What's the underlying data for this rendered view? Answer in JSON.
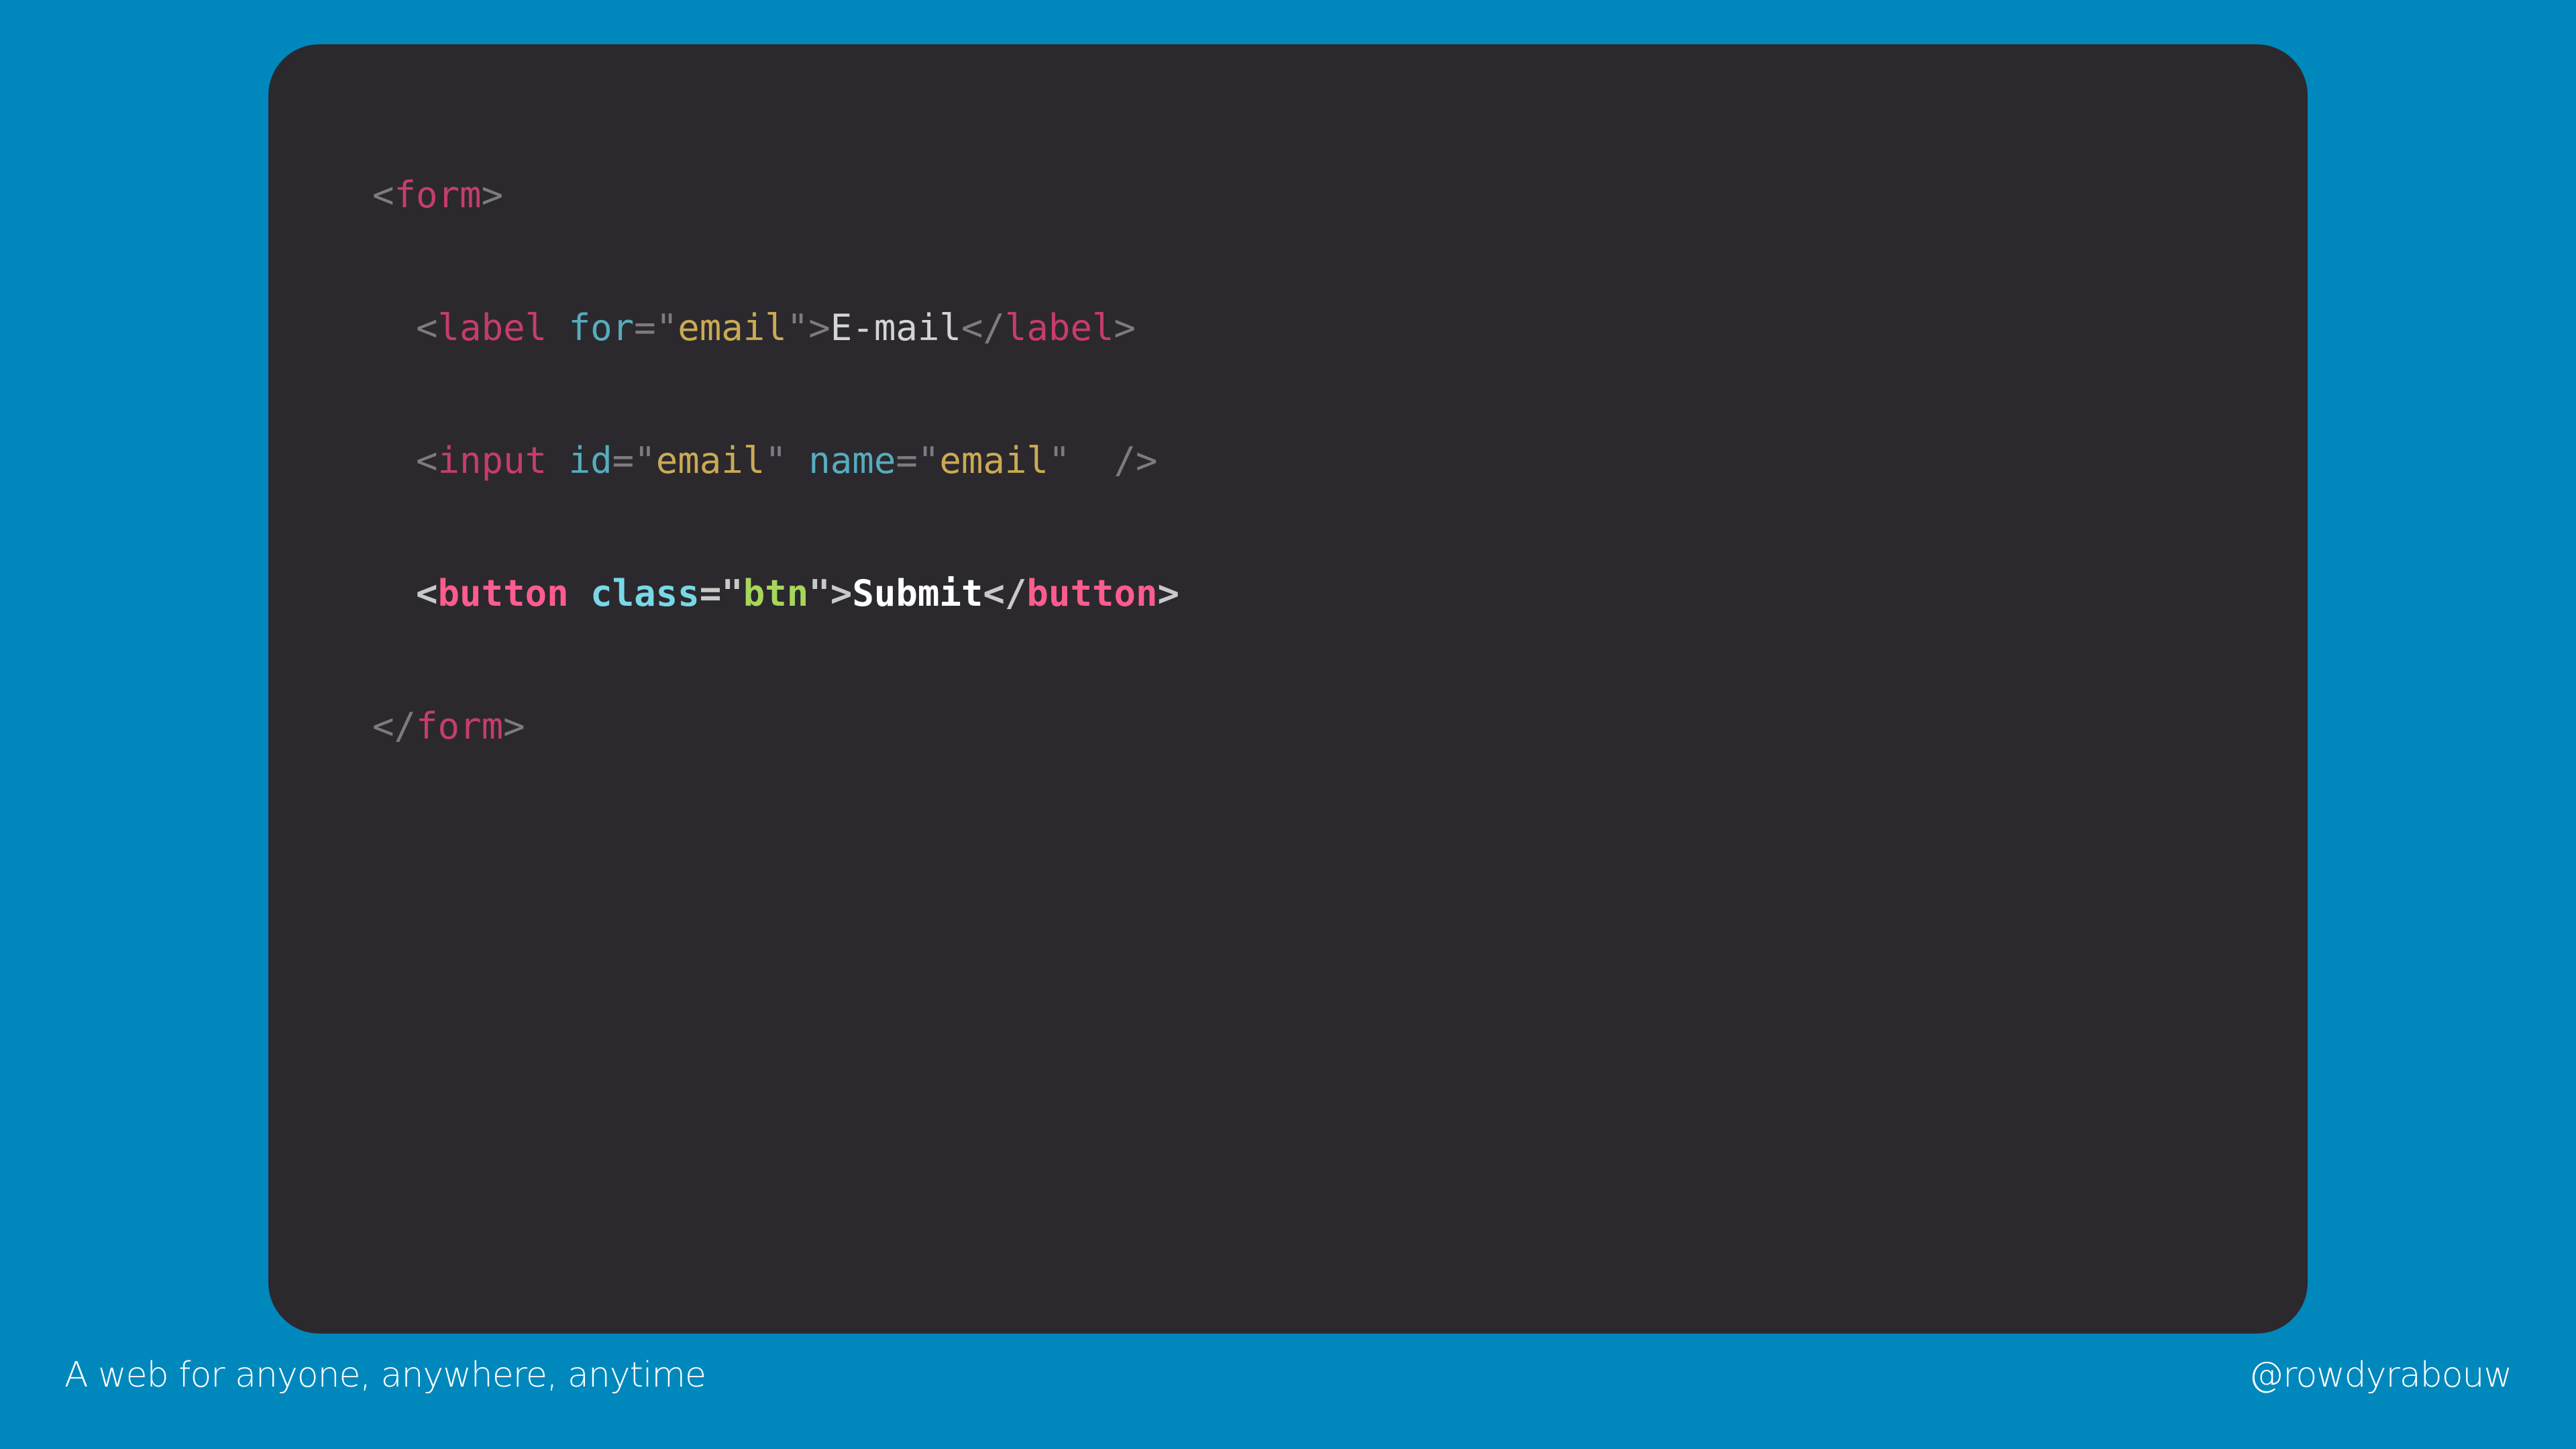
{
  "slide": {
    "background_color": "#0088bd",
    "panel_color": "#2b292e"
  },
  "code": {
    "line1": {
      "open": "<",
      "tag": "form",
      "close": ">"
    },
    "line2": {
      "indent": "  ",
      "open": "<",
      "tag": "label",
      "attr": "for",
      "eq": "=",
      "q1": "\"",
      "value": "email",
      "q2": "\"",
      "close": ">",
      "text": "E-mail",
      "end_open": "</",
      "end_tag": "label",
      "end_close": ">"
    },
    "line3": {
      "indent": "  ",
      "open": "<",
      "tag": "input",
      "attr1": "id",
      "eq1": "=",
      "q1": "\"",
      "value1": "email",
      "q2": "\"",
      "attr2": "name",
      "eq2": "=",
      "q3": "\"",
      "value2": "email",
      "q4": "\"",
      "self_close": "/>"
    },
    "line4": {
      "indent": "  ",
      "open": "<",
      "tag": "button",
      "attr": "class",
      "eq": "=",
      "q1": "\"",
      "value": "btn",
      "q2": "\"",
      "close": ">",
      "text": "Submit",
      "end_open": "</",
      "end_tag": "button",
      "end_close": ">"
    },
    "line5": {
      "open": "</",
      "tag": "form",
      "close": ">"
    },
    "colors": {
      "tag": "#e2407a",
      "attribute": "#5ec4d6",
      "string": "#e8c15a",
      "highlight_string": "#a6d65a",
      "text": "#f2f2f2",
      "punctuation": "#8c8a8f"
    }
  },
  "footer": {
    "tagline": "A web for anyone, anywhere, anytime",
    "handle": "@rowdyrabouw"
  }
}
